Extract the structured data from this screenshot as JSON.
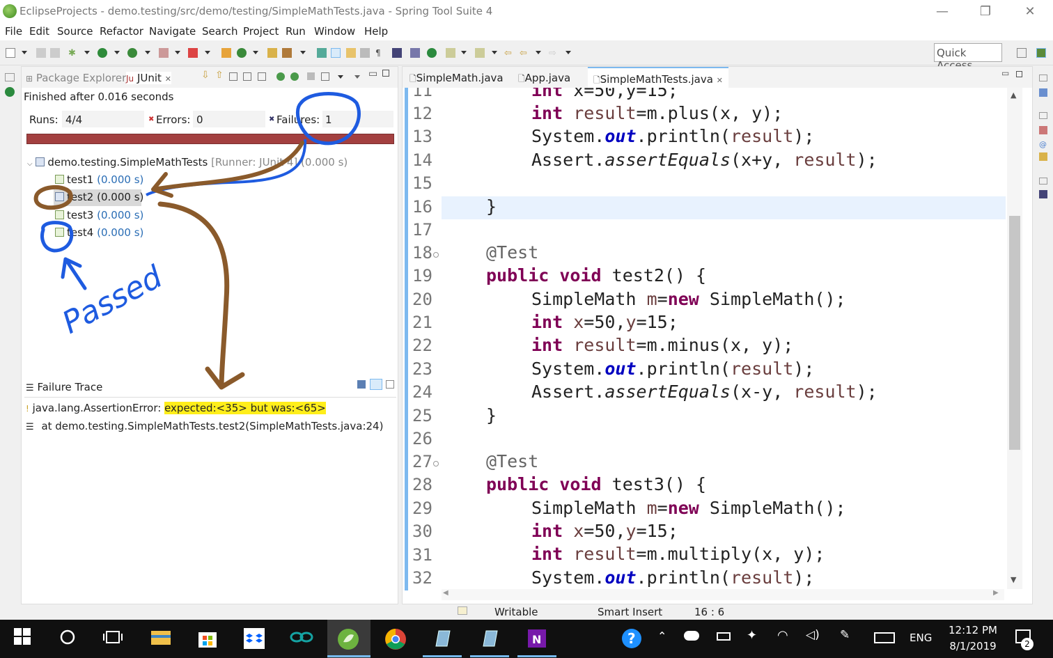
{
  "window": {
    "title": "EclipseProjects - demo.testing/src/demo/testing/SimpleMathTests.java - Spring Tool Suite 4",
    "minimize": "—",
    "restore": "❐",
    "close": "✕"
  },
  "menu": [
    "File",
    "Edit",
    "Source",
    "Refactor",
    "Navigate",
    "Search",
    "Project",
    "Run",
    "Window",
    "Help"
  ],
  "toolbar": {
    "quick_access": "Quick Access"
  },
  "junit": {
    "tabs": {
      "package_explorer": "Package Explorer",
      "junit": "JUnit",
      "close": "✕"
    },
    "finished": "Finished after 0.016 seconds",
    "runs_label": "Runs:",
    "runs_value": "4/4",
    "errors_label": "Errors:",
    "errors_value": "0",
    "failures_label": "Failures:",
    "failures_value": "1",
    "progress_state": "failed",
    "tree": {
      "suite_name": "demo.testing.SimpleMathTests",
      "suite_suffix": "[Runner: JUnit 4] (0.000 s)",
      "tests": [
        {
          "name": "test1",
          "time": "(0.000 s)",
          "status": "passed"
        },
        {
          "name": "test2",
          "time": "(0.000 s)",
          "status": "failed"
        },
        {
          "name": "test3",
          "time": "(0.000 s)",
          "status": "passed"
        },
        {
          "name": "test4",
          "time": "(0.000 s)",
          "status": "passed"
        }
      ]
    },
    "trace": {
      "header": "Failure Trace",
      "error_prefix": "java.lang.AssertionError: ",
      "error_highlight": "expected:<35> but was:<65>",
      "at_line": "at demo.testing.SimpleMathTests.test2(SimpleMathTests.java:24)"
    }
  },
  "annotation": {
    "handwritten": "Passed"
  },
  "editor": {
    "tabs": [
      "SimpleMath.java",
      "App.java",
      "SimpleMathTests.java"
    ],
    "active_tab": "SimpleMathTests.java",
    "line_numbers": [
      "11",
      "12",
      "13",
      "14",
      "15",
      "16",
      "17",
      "18",
      "19",
      "20",
      "21",
      "22",
      "23",
      "24",
      "25",
      "26",
      "27",
      "28",
      "29",
      "30",
      "31",
      "32"
    ],
    "current_line": "16"
  },
  "status": {
    "writable": "Writable",
    "insert": "Smart Insert",
    "position": "16 : 6"
  },
  "taskbar": {
    "time": "12:12 PM",
    "date": "8/1/2019",
    "lang": "ENG",
    "notifications": "2"
  }
}
